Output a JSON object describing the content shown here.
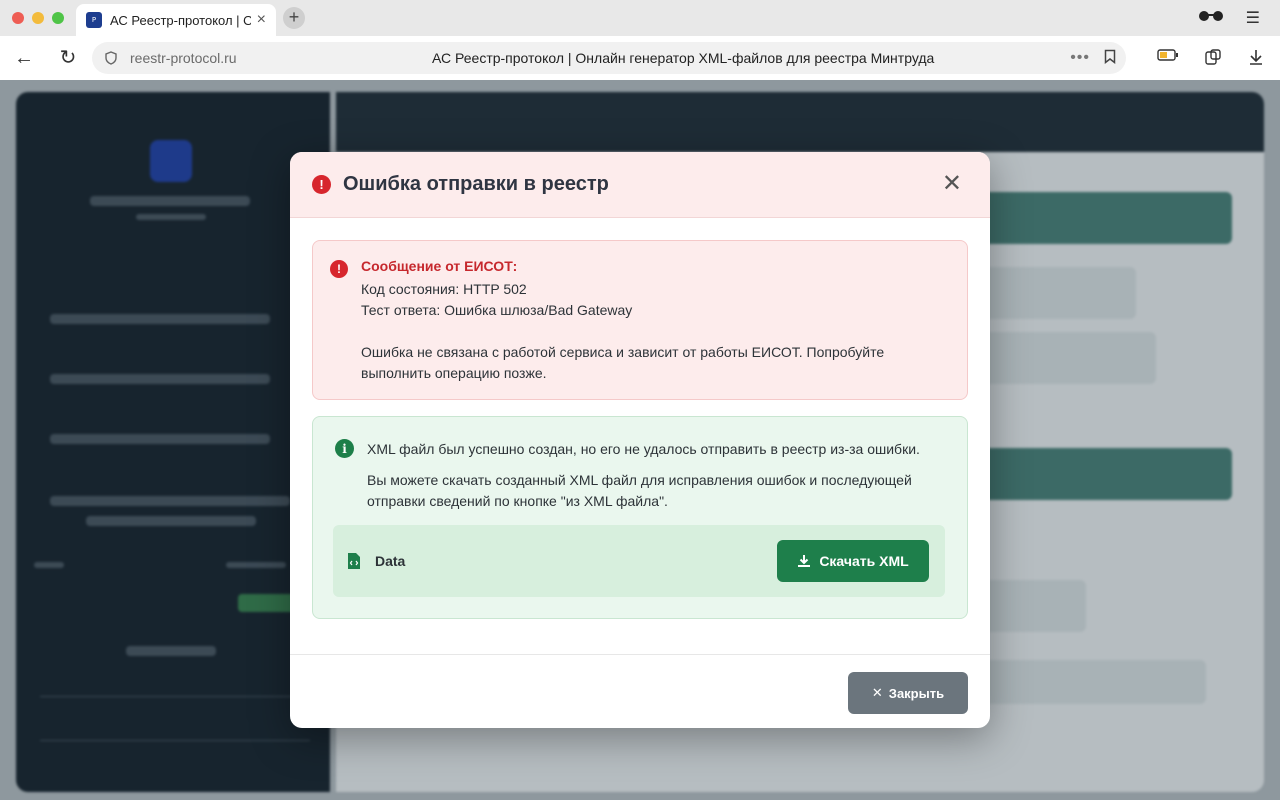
{
  "browser": {
    "tab_title": "АС Реестр-протокол | О",
    "tab_favicon_text": "P",
    "url": "reestr-protocol.ru",
    "page_title": "АС Реестр-протокол | Онлайн генератор XML-файлов для реестра Минтруда"
  },
  "modal": {
    "title": "Ошибка отправки в реестр",
    "close_symbol": "✕",
    "error_alert": {
      "title": "Сообщение от ЕИСОТ:",
      "status_line": "Код состояния: HTTP 502",
      "response_line": "Тест ответа: Ошибка шлюза/Bad Gateway",
      "note_line_1": "Ошибка не связана с работой сервиса и зависит от работы ЕИСОТ. Попробуйте",
      "note_line_2": "выполнить операцию позже."
    },
    "success_alert": {
      "line_1": "XML файл был успешно создан, но его не удалось отправить в реестр из-за ошибки.",
      "line_2": "Вы можете скачать созданный XML файл для исправления ошибок и последующей",
      "line_3": "отправки сведений по кнопке \"из XML файла\"."
    },
    "file": {
      "name": "Data",
      "download_label": "Скачать XML"
    },
    "footer": {
      "close_label": "Закрыть"
    }
  },
  "colors": {
    "danger": "#d7262d",
    "success": "#1e7f4b",
    "secondary": "#6b757d"
  }
}
